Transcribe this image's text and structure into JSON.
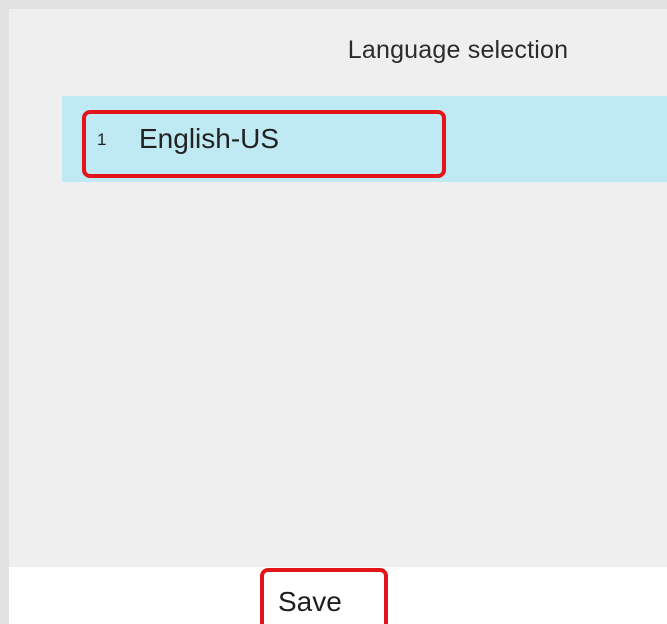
{
  "screen": {
    "title": "Language selection"
  },
  "language_list": {
    "items": [
      {
        "index": "1",
        "label": "English-US",
        "selected": true
      }
    ]
  },
  "softkeys": {
    "save_label": "Save"
  },
  "colors": {
    "selected_row": "#bfeaf4",
    "highlight_outline": "#e3141a",
    "background": "#efefef"
  }
}
